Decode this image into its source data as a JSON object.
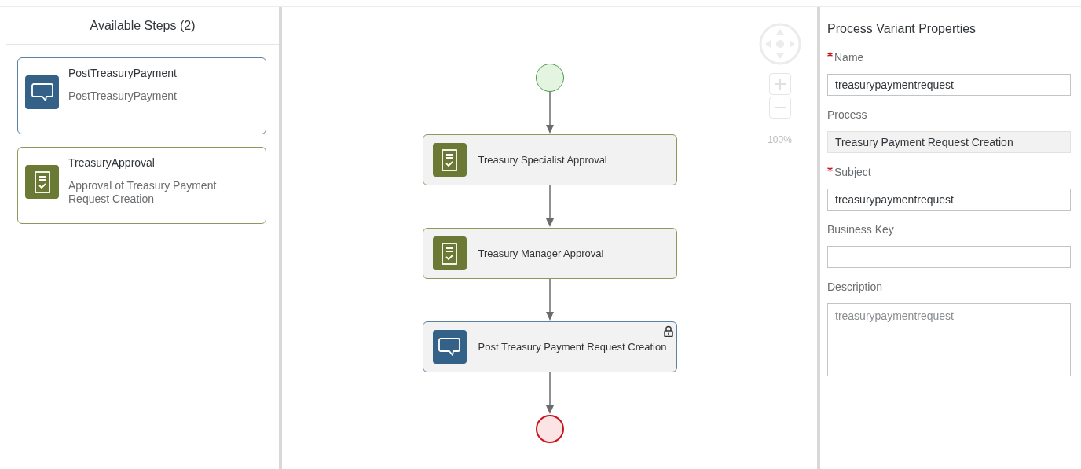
{
  "steps_panel": {
    "title": "Available Steps (2)",
    "steps": [
      {
        "kind": "message",
        "title": "PostTreasuryPayment",
        "description": "PostTreasuryPayment"
      },
      {
        "kind": "approval",
        "title": "TreasuryApproval",
        "description": "Approval of Treasury Payment Request Creation"
      }
    ]
  },
  "canvas": {
    "zoom_label": "100%",
    "nodes": [
      {
        "kind": "start"
      },
      {
        "kind": "approval",
        "label": "Treasury Specialist Approval",
        "locked": false
      },
      {
        "kind": "approval",
        "label": "Treasury Manager Approval",
        "locked": false
      },
      {
        "kind": "message",
        "label": "Post Treasury Payment Request Creation",
        "locked": true
      },
      {
        "kind": "end"
      }
    ]
  },
  "properties": {
    "title": "Process Variant Properties",
    "fields": [
      {
        "kind": "input",
        "label": "Name",
        "required": true,
        "value": "treasurypaymentrequest"
      },
      {
        "kind": "readonly",
        "label": "Process",
        "required": false,
        "value": "Treasury Payment Request Creation"
      },
      {
        "kind": "input",
        "label": "Subject",
        "required": true,
        "value": "treasurypaymentrequest"
      },
      {
        "kind": "input",
        "label": "Business Key",
        "required": false
      },
      {
        "kind": "textarea",
        "label": "Description",
        "required": false,
        "placeholder": "treasurypaymentrequest"
      }
    ]
  }
}
